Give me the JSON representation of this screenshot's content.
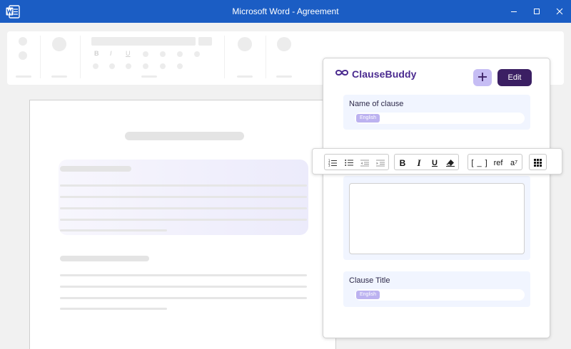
{
  "window": {
    "title": "Microsoft Word - Agreement",
    "app_icon": "word-icon",
    "controls": [
      "minimize-icon",
      "maximize-icon",
      "close-icon"
    ]
  },
  "ribbon": {
    "letters": [
      "B",
      "I",
      "U"
    ]
  },
  "clausebuddy": {
    "brand": "ClauseBuddy",
    "add_icon": "plus-icon",
    "edit_label": "Edit",
    "fields": [
      {
        "label": "Name of clause",
        "chip": "English"
      },
      {
        "label": "Clause Title",
        "chip": "English"
      }
    ]
  },
  "toolbar": {
    "list_group": [
      "numbered-list-icon",
      "bullet-list-icon",
      "outdent-icon",
      "indent-icon"
    ],
    "format_group": {
      "bold": "B",
      "italic": "I",
      "underline": "U",
      "eraser": "eraser-icon"
    },
    "insert_group": {
      "placeholder": "[ _ ]",
      "ref": "ref",
      "superscript_base": "a",
      "superscript_exp": "7"
    },
    "grid_icon": "grid-icon"
  },
  "colors": {
    "titlebar": "#1b5dc4",
    "brand": "#4a2a8f",
    "edit_button": "#3b1f63",
    "add_button": "#c6bdf4",
    "field_bg": "#f1f5ff",
    "chip": "#bcb2f0"
  }
}
